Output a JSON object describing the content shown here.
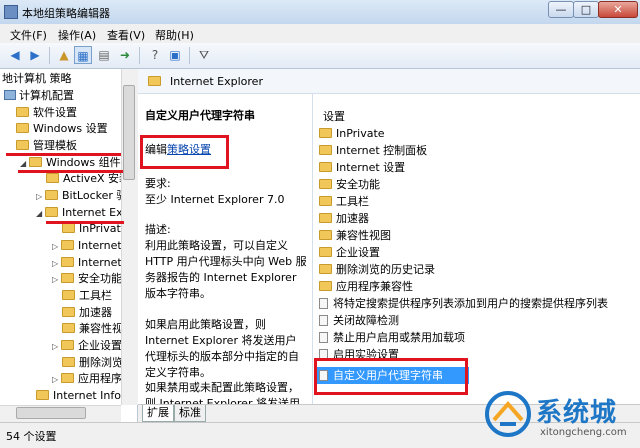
{
  "window": {
    "title": "本地组策略编辑器",
    "min": "—",
    "max": "□",
    "close": "✕"
  },
  "menu": [
    "文件(F)",
    "操作(A)",
    "查看(V)",
    "帮助(H)"
  ],
  "toolbar": {
    "back_icon": "back-arrow-icon",
    "forward_icon": "forward-arrow-icon"
  },
  "tree": [
    {
      "label": "地计算机 策略",
      "type": "pc"
    },
    {
      "label": "计算机配置",
      "type": "pc"
    },
    {
      "label": "软件设置"
    },
    {
      "label": "Windows 设置"
    },
    {
      "label": "管理模板"
    },
    {
      "label": "Windows 组件"
    },
    {
      "label": "ActiveX 安装"
    },
    {
      "label": "BitLocker 驱"
    },
    {
      "label": "Internet Exp"
    },
    {
      "label": "InPrivate"
    },
    {
      "label": "Internet"
    },
    {
      "label": "Internet"
    },
    {
      "label": "安全功能"
    },
    {
      "label": "工具栏"
    },
    {
      "label": "加速器"
    },
    {
      "label": "兼容性视"
    },
    {
      "label": "企业设置"
    },
    {
      "label": "删除浏览"
    },
    {
      "label": "应用程序"
    },
    {
      "label": "Internet Info"
    }
  ],
  "header": {
    "title": "Internet Explorer"
  },
  "description": {
    "policy_title": "自定义用户代理字符串",
    "edit_prefix": "编辑",
    "edit_link": "策略设置",
    "req_label": "要求:",
    "req_value": "至少 Internet Explorer 7.0",
    "desc_label": "描述:",
    "desc_text": "利用此策略设置，可以自定义 HTTP 用户代理标头中向 Web 服务器报告的 Internet Explorer 版本字符串。",
    "para2": "如果启用此策略设置，则 Internet Explorer 将发送用户代理标头的版本部分中指定的自定义字符串。",
    "para3": "如果禁用或未配置此策略设置，则 Internet Explorer 将发送用户代理"
  },
  "list": {
    "column": "设置",
    "folders": [
      "InPrivate",
      "Internet 控制面板",
      "Internet 设置",
      "安全功能",
      "工具栏",
      "加速器",
      "兼容性视图",
      "企业设置",
      "删除浏览的历史记录",
      "应用程序兼容性"
    ],
    "settings": [
      "将特定搜索提供程序列表添加到用户的搜索提供程序列表",
      "关闭故障检测",
      "禁止用户启用或禁用加载项",
      "启用实验设置",
      "自定义用户代理字符串"
    ],
    "selected": "自定义用户代理字符串"
  },
  "tabs": [
    "扩展",
    "标准"
  ],
  "status": {
    "text": "54 个设置"
  },
  "watermark": {
    "cn": "系统城",
    "en": "xitongcheng.com"
  },
  "colors": {
    "selection": "#3399ff",
    "annotation": "#e0141e",
    "folder": "#f1c75a"
  }
}
